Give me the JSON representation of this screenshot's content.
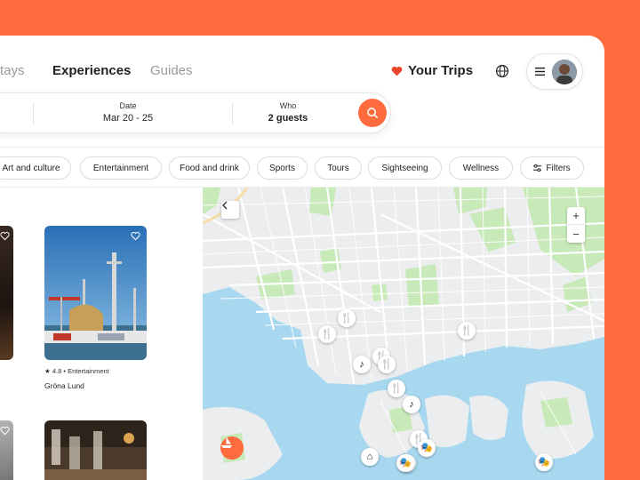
{
  "nav": {
    "tabs": [
      {
        "label": "Stays"
      },
      {
        "label": "Experiences"
      },
      {
        "label": "Guides"
      }
    ],
    "trips_label": "Your Trips"
  },
  "search": {
    "date_label": "Date",
    "date_value": "Mar 20 - 25",
    "who_label": "Who",
    "who_value": "2 guests"
  },
  "categories": [
    "Art and culture",
    "Entertainment",
    "Food and drink",
    "Sports",
    "Tours",
    "Sightseeing",
    "Wellness"
  ],
  "filters_label": "Filters",
  "listings": [
    {
      "rating": "4.8",
      "category": "Entertainment",
      "title": "Gröna Lund"
    }
  ],
  "map": {
    "zoom_in": "+",
    "zoom_out": "−",
    "pins": [
      "food",
      "food",
      "food",
      "music",
      "food",
      "food",
      "food",
      "music",
      "food",
      "theater",
      "food",
      "museum",
      "theater",
      "theater"
    ]
  },
  "colors": {
    "accent": "#FF6B3D",
    "heart": "#E8452C",
    "water": "#A7D8F0",
    "park": "#C8E9B8"
  }
}
